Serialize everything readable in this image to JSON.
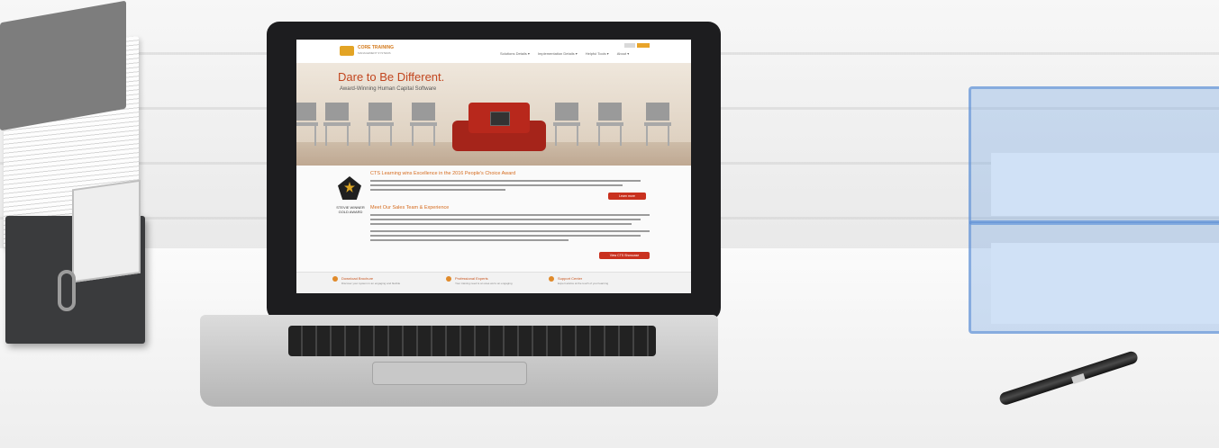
{
  "site": {
    "logo_text": "CORE TRAINING",
    "logo_sub": "MANAGEMENT SYSTEMS",
    "nav": [
      "Solutions Details ▾",
      "Implementation Details ▾",
      "Helpful Tools ▾",
      "About ▾"
    ],
    "hero": {
      "title": "Dare to Be Different.",
      "subtitle": "Award-Winning Human Capital Software"
    },
    "award_text": "STEVIE WINNER GOLD AWARD",
    "section1_heading": "CTS Learning wins Excellence in the 2016 People's Choice Award",
    "section1_button": "Learn more",
    "section2_heading": "Meet Our Sales Team & Experience",
    "section2_button": "View CTS Showcase",
    "footer": [
      {
        "title": "Download Brochure",
        "sub": "Discover your system in an engaging and flexible"
      },
      {
        "title": "Professional Experts",
        "sub": "Your training need is an area we're an engaging"
      },
      {
        "title": "Support Center",
        "sub": "Expert advice at the touch of your learning"
      }
    ]
  }
}
